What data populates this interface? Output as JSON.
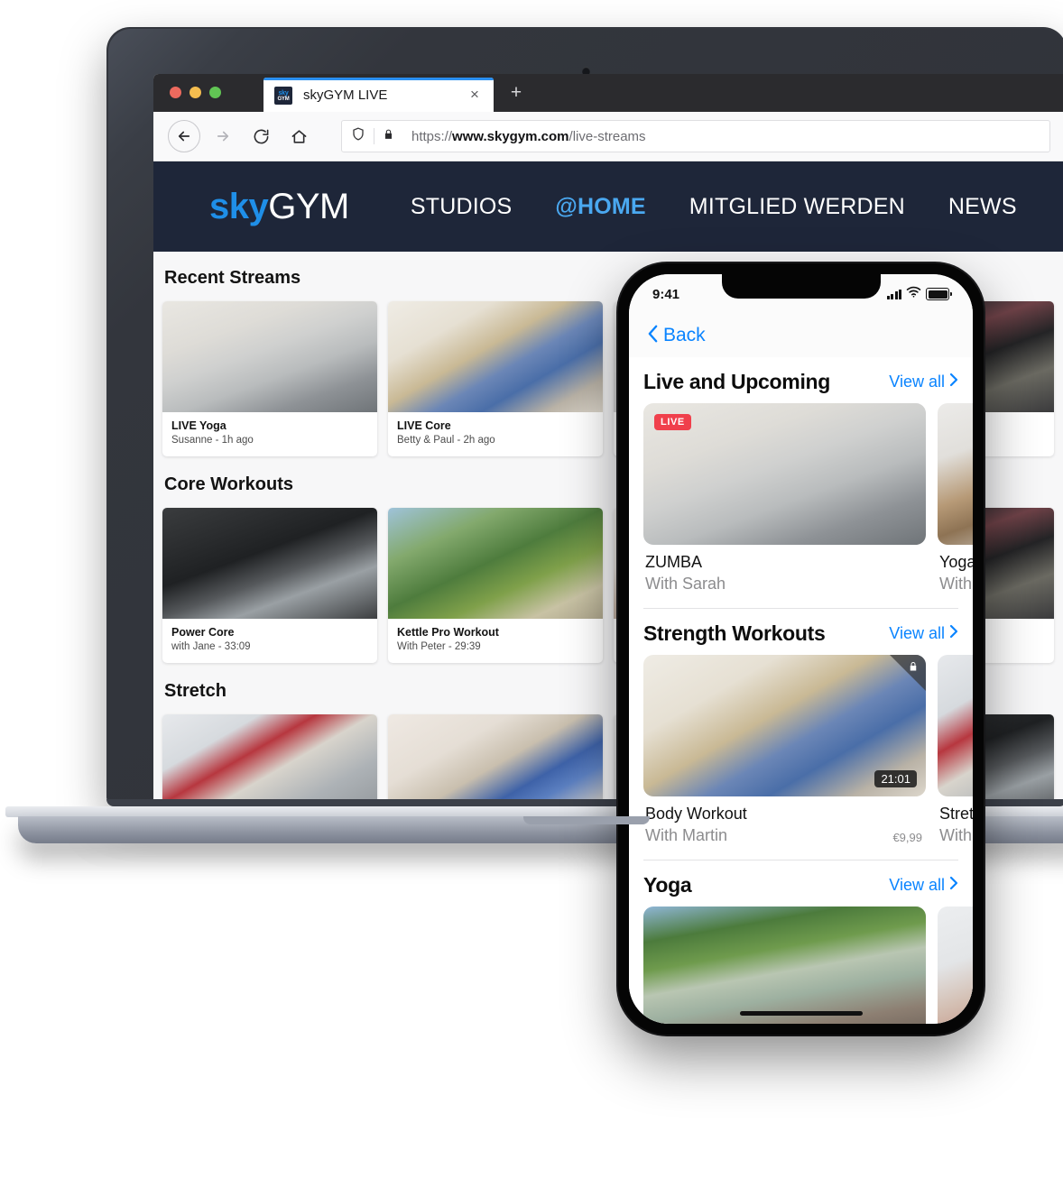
{
  "browser": {
    "tab": {
      "title": "skyGYM LIVE",
      "favicon_top": "sky",
      "favicon_bottom": "GYM",
      "close_icon": "×",
      "new_tab_icon": "+"
    },
    "toolbar": {
      "back_icon": "←",
      "forward_icon": "→",
      "reload_icon": "⟳",
      "home_icon": "⌂",
      "shield_icon": "shield",
      "lock_icon": "lock",
      "url_scheme": "https://",
      "url_domain": "www.skygym.com",
      "url_path": "/live-streams"
    }
  },
  "site": {
    "logo": {
      "part1": "sky",
      "part2": "GYM"
    },
    "menu": [
      {
        "label": "STUDIOS",
        "active": false
      },
      {
        "label": "@HOME",
        "active": true
      },
      {
        "label": "MITGLIED WERDEN",
        "active": false
      },
      {
        "label": "NEWS",
        "active": false
      }
    ],
    "sections": [
      {
        "title": "Recent Streams",
        "cards": [
          {
            "title": "LIVE Yoga",
            "subtitle": "Susanne - 1h ago",
            "photo": "ph-yoga-room"
          },
          {
            "title": "LIVE Core",
            "subtitle": "Betty & Paul - 2h ago",
            "photo": "ph-core-home"
          },
          {
            "title": "",
            "subtitle": "",
            "photo": "ph-rack"
          },
          {
            "title": "",
            "subtitle": "",
            "photo": "ph-grey"
          }
        ]
      },
      {
        "title": "Core Workouts",
        "cards": [
          {
            "title": "Power Core",
            "subtitle": "with Jane - 33:09",
            "photo": "ph-gym-dark"
          },
          {
            "title": "Kettle Pro Workout",
            "subtitle": "With Peter - 29:39",
            "photo": "ph-outdoor"
          },
          {
            "title": "",
            "subtitle": "",
            "photo": "ph-mat"
          },
          {
            "title": "",
            "subtitle": "",
            "photo": "ph-rack"
          }
        ]
      },
      {
        "title": "Stretch",
        "cards": [
          {
            "title": "",
            "subtitle": "",
            "photo": "ph-studio"
          },
          {
            "title": "",
            "subtitle": "",
            "photo": "ph-stretch-m"
          },
          {
            "title": "",
            "subtitle": "",
            "photo": "ph-grey"
          },
          {
            "title": "",
            "subtitle": "",
            "photo": "ph-gym-dark"
          }
        ]
      }
    ]
  },
  "phone": {
    "status": {
      "time": "9:41",
      "signal_icon": "cellular-bars",
      "wifi_icon": "wifi",
      "battery_icon": "battery-full"
    },
    "nav": {
      "back_label": "Back",
      "back_icon": "‹"
    },
    "view_all_label": "View all",
    "chevron_icon": "›",
    "sections": [
      {
        "title": "Live and Upcoming",
        "view_all": "View all",
        "cards": [
          {
            "title": "ZUMBA",
            "subtitle": "With Sarah",
            "badge": "LIVE",
            "photo": "ph-yoga-room",
            "duration": "",
            "price": "",
            "locked": false
          },
          {
            "title": "Yoga",
            "subtitle": "With",
            "badge": "",
            "photo": "ph-dresser",
            "duration": "",
            "price": "",
            "locked": false
          }
        ]
      },
      {
        "title": "Strength Workouts",
        "view_all": "View all",
        "cards": [
          {
            "title": "Body Workout",
            "subtitle": "With Martin",
            "badge": "",
            "photo": "ph-core-home",
            "duration": "21:01",
            "price": "€9,99",
            "locked": true
          },
          {
            "title": "Stretch",
            "subtitle": "With Sarah",
            "badge": "",
            "photo": "ph-studio",
            "duration": "",
            "price": "",
            "locked": false
          }
        ]
      },
      {
        "title": "Yoga",
        "view_all": "View all",
        "cards": [
          {
            "title": "",
            "subtitle": "",
            "badge": "",
            "photo": "ph-lake",
            "duration": "",
            "price": "",
            "locked": false
          },
          {
            "title": "",
            "subtitle": "",
            "badge": "",
            "photo": "ph-updog",
            "duration": "",
            "price": "",
            "locked": false
          }
        ]
      }
    ]
  },
  "colors": {
    "brand_blue": "#1f8fe8",
    "nav_navy": "#1e2639",
    "ios_blue": "#0a84ff",
    "live_red": "#f0404c",
    "page_bg": "#f7f7f8"
  }
}
